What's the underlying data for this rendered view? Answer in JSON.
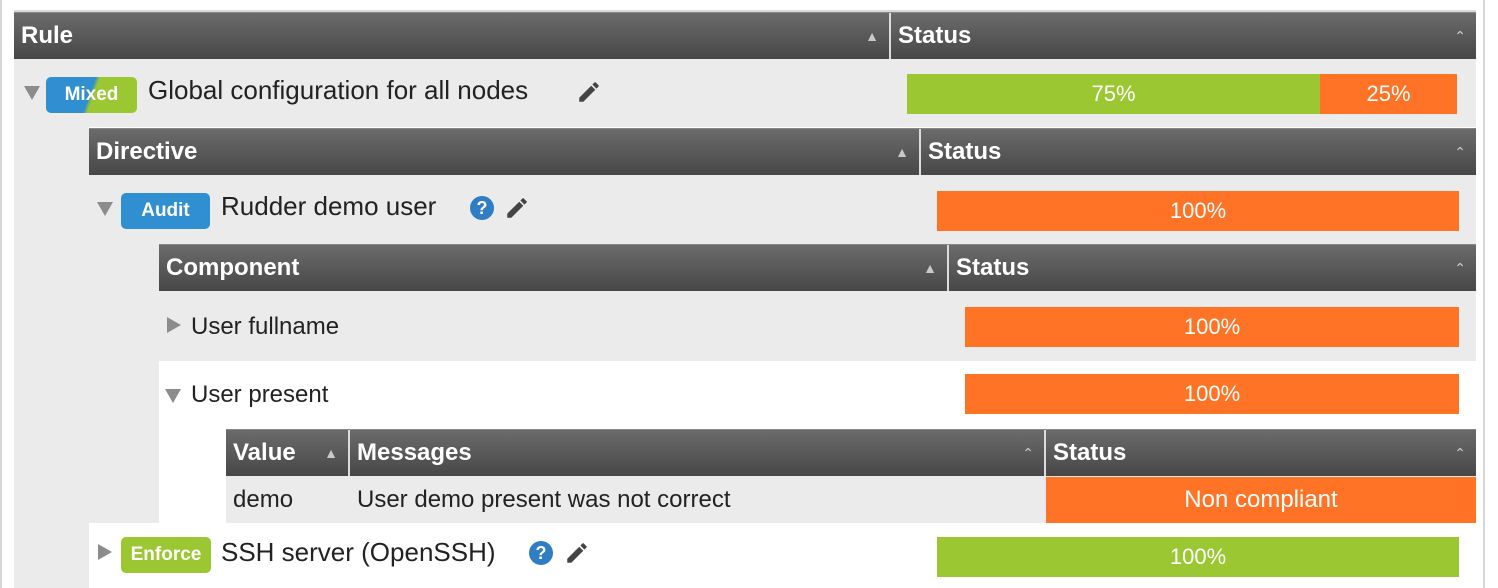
{
  "headers": {
    "rule": "Rule",
    "directive": "Directive",
    "component": "Component",
    "value": "Value",
    "messages": "Messages",
    "status": "Status"
  },
  "rule": {
    "badge": "Mixed",
    "name": "Global configuration for all nodes",
    "compliance": [
      {
        "label": "75%",
        "value": 75,
        "color": "#9bc832"
      },
      {
        "label": "25%",
        "value": 25,
        "color": "#ff7326"
      }
    ]
  },
  "directives": [
    {
      "badge": "Audit",
      "name": "Rudder demo user",
      "status": "100%",
      "components": [
        {
          "name": "User fullname",
          "status": "100%"
        },
        {
          "name": "User present",
          "status": "100%",
          "values": [
            {
              "value": "demo",
              "message": "User demo present was not correct",
              "status": "Non compliant"
            }
          ]
        }
      ]
    },
    {
      "badge": "Enforce",
      "name": "SSH server (OpenSSH)",
      "status": "100%"
    }
  ],
  "colors": {
    "success": "#9bc832",
    "error": "#ff7326",
    "audit": "#2f8fd0",
    "enforce": "#9bc832",
    "header": "#555555"
  },
  "icons": {
    "sort": "sort-up-icon",
    "expand": "triangle-down-icon",
    "collapse": "triangle-right-icon",
    "edit": "pencil-icon",
    "help": "question-circle-icon"
  }
}
